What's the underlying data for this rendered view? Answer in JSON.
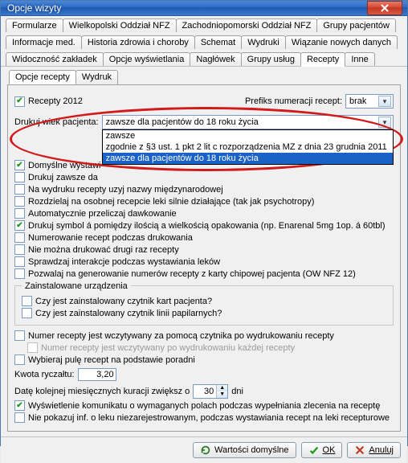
{
  "window": {
    "title": "Opcje wizyty"
  },
  "tabs_row1": [
    "Formularze",
    "Wielkopolski Oddział NFZ",
    "Zachodniopomorski Oddział NFZ",
    "Grupy pacjentów"
  ],
  "tabs_row2": [
    "Informacje med.",
    "Historia zdrowia i choroby",
    "Schemat",
    "Wydruki",
    "Wiązanie nowych danych"
  ],
  "tabs_row3": [
    "Widoczność zakładek",
    "Opcje wyświetlania",
    "Nagłówek",
    "Grupy usług",
    "Recepty",
    "Inne"
  ],
  "tabs_row3_active": 4,
  "subtabs": [
    "Opcje recepty",
    "Wydruk"
  ],
  "subtabs_active": 0,
  "prefix": {
    "recepty2012": "Recepty 2012",
    "prefiks_label": "Prefiks numeracji recept:",
    "prefiks_value": "brak"
  },
  "wiek": {
    "label": "Drukuj wiek pacjenta:",
    "selected": "zawsze dla pacjentów do 18 roku życia",
    "options": [
      "zawsze",
      "zgodnie z §3 ust. 1 pkt 2 lit c rozporządzenia MZ z dnia 23 grudnia 2011",
      "zawsze dla pacjentów do 18 roku życia"
    ],
    "selected_index": 2
  },
  "opts": [
    {
      "label": "Domyślne wystawi",
      "checked": true
    },
    {
      "label": "Drukuj zawsze da",
      "checked": false
    },
    {
      "label": "Na wydruku recepty uzyj nazwy międzynarodowej",
      "checked": false
    },
    {
      "label": "Rozdzielaj na osobnej recepcie leki silnie działające (tak jak psychotropy)",
      "checked": false
    },
    {
      "label": "Automatycznie przeliczaj dawkowanie",
      "checked": false
    },
    {
      "label": "Drukuj symbol á pomiędzy ilością a wielkością opakowania (np. Enarenal 5mg 1op. á 60tbl)",
      "checked": true
    },
    {
      "label": "Numerowanie recept podczas drukowania",
      "checked": false
    },
    {
      "label": "Nie można drukować drugi raz recepty",
      "checked": false
    },
    {
      "label": "Sprawdzaj interakcje podczas wystawiania leków",
      "checked": false
    },
    {
      "label": "Pozwalaj na generowanie numerów recepty z karty chipowej pacjenta  (OW NFZ 12)",
      "checked": false
    }
  ],
  "zainst": {
    "title": "Zainstalowane urządzenia",
    "items": [
      {
        "label": "Czy jest zainstalowany czytnik kart pacjenta?",
        "checked": false
      },
      {
        "label": "Czy jest zainstalowany czytnik linii papilarnych?",
        "checked": false
      }
    ]
  },
  "lower": [
    {
      "label": "Numer recepty jest wczytywany za pomocą czytnika po wydrukowaniu recepty",
      "checked": false,
      "disabled": false
    },
    {
      "label": "Numer recepty jest wczytywany po wydrukowaniu każdej recepty",
      "checked": false,
      "disabled": true
    },
    {
      "label": "Wybieraj pulę recept na podstawie poradni",
      "checked": false,
      "disabled": false
    }
  ],
  "kwota": {
    "label": "Kwota ryczałtu:",
    "value": "3,20"
  },
  "kuracja": {
    "pre": "Datę kolejnej miesięcznych kuracji  zwiększ o",
    "value": "30",
    "post": "dni"
  },
  "final": [
    {
      "label": "Wyświetlenie komunikatu o wymaganych polach podczas wypełniania zlecenia na receptę",
      "checked": true
    },
    {
      "label": "Nie pokazuj inf. o leku niezarejestrowanym, podczas wystawiania recept na leki recepturowe",
      "checked": false
    }
  ],
  "footer": {
    "defaults": "Wartości domyślne",
    "ok": "OK",
    "cancel": "Anuluj"
  }
}
